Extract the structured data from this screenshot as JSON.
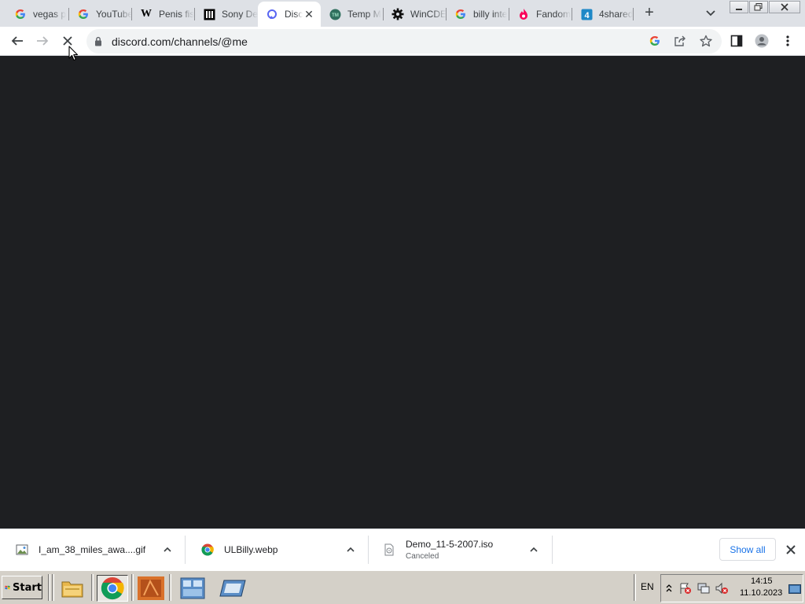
{
  "browser": {
    "tabs": [
      {
        "title": "vegas p",
        "icon": "google-icon"
      },
      {
        "title": "YouTube",
        "icon": "google-icon"
      },
      {
        "title": "Penis fis",
        "icon": "wikipedia-icon"
      },
      {
        "title": "Sony De",
        "icon": "museum-icon"
      },
      {
        "title": "Disc",
        "icon": "discord-icon",
        "active": true
      },
      {
        "title": "Temp M",
        "icon": "tempmail-icon"
      },
      {
        "title": "WinCDE",
        "icon": "gear-icon"
      },
      {
        "title": "billy inte",
        "icon": "google-icon"
      },
      {
        "title": "Fandom",
        "icon": "fandom-icon"
      },
      {
        "title": "4shared",
        "icon": "4shared-icon"
      }
    ],
    "url": "discord.com/channels/@me"
  },
  "downloads": {
    "items": [
      {
        "name": "I_am_38_miles_awa....gif",
        "status": ""
      },
      {
        "name": "ULBilly.webp",
        "status": ""
      },
      {
        "name": "Demo_11-5-2007.iso",
        "status": "Canceled"
      }
    ],
    "show_all": "Show all"
  },
  "taskbar": {
    "start_label": "Start",
    "language": "EN",
    "time": "14:15",
    "date": "11.10.2023"
  },
  "colors": {
    "content_bg": "#1e1f22",
    "tabstrip_bg": "#dee1e6",
    "link_blue": "#1a73e8",
    "taskbar_bg": "#d4d0c8"
  }
}
